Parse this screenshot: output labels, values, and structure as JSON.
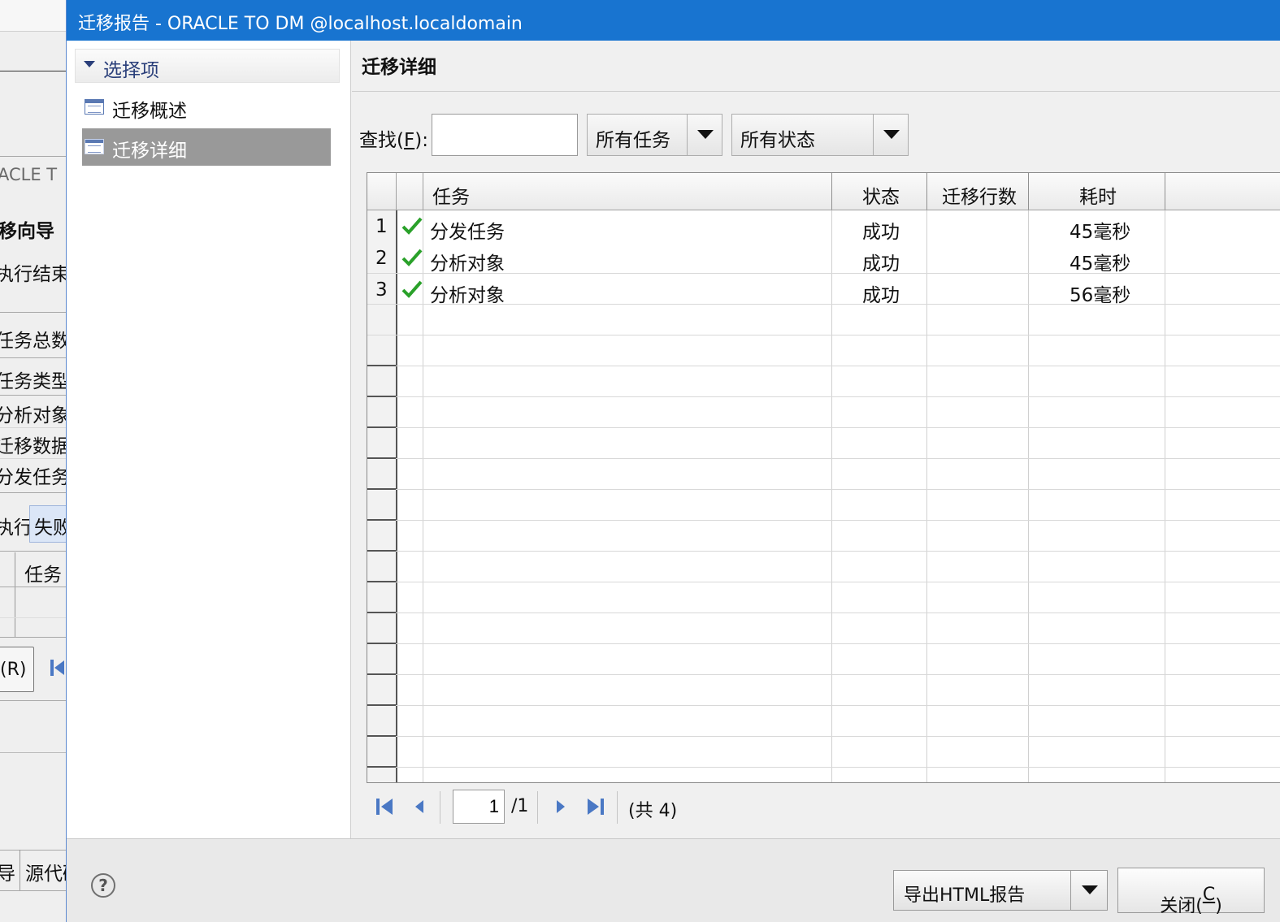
{
  "background_window": {
    "items": [
      "ACLE T",
      "移向导",
      "执行结束",
      "任务总数:",
      "任务类型",
      "分析对象",
      "迁移数据",
      "分发任务",
      "执行",
      "失败",
      "任务",
      "(R)",
      "导",
      "源代码"
    ]
  },
  "dialog": {
    "title": "迁移报告 - ORACLE TO DM @localhost.localdomain"
  },
  "nav": {
    "section": "选择项",
    "items": [
      {
        "label": "迁移概述",
        "icon": "list-icon",
        "selected": false
      },
      {
        "label": "迁移详细",
        "icon": "list-icon",
        "selected": true
      }
    ]
  },
  "content": {
    "title": "迁移详细",
    "find_label": "查找(",
    "find_key": "F",
    "find_suffix": "):",
    "search_value": "",
    "task_filter": "所有任务",
    "status_filter": "所有状态"
  },
  "table": {
    "columns": [
      "任务",
      "状态",
      "迁移行数",
      "耗时"
    ],
    "rows": [
      {
        "num": "1",
        "task": "分发任务",
        "status": "成功",
        "rows": "",
        "time": "45毫秒",
        "icon": "check-icon"
      },
      {
        "num": "2",
        "task": "分析对象",
        "status": "成功",
        "rows": "",
        "time": "45毫秒",
        "icon": "check-icon"
      },
      {
        "num": "3",
        "task": "分析对象",
        "status": "成功",
        "rows": "",
        "time": "56毫秒",
        "icon": "check-icon"
      }
    ]
  },
  "pager": {
    "current_page": "1",
    "total_pages": "/1",
    "count_text": "(共 4)"
  },
  "footer": {
    "help_icon": "?",
    "export_label": "导出HTML报告",
    "close_label": "关闭(",
    "close_key": "C",
    "close_suffix": ")"
  },
  "colors": {
    "titlebar": "#1874d0",
    "selection": "#999999",
    "check": "#2aa12a",
    "pager_icon": "#4a78c4"
  }
}
